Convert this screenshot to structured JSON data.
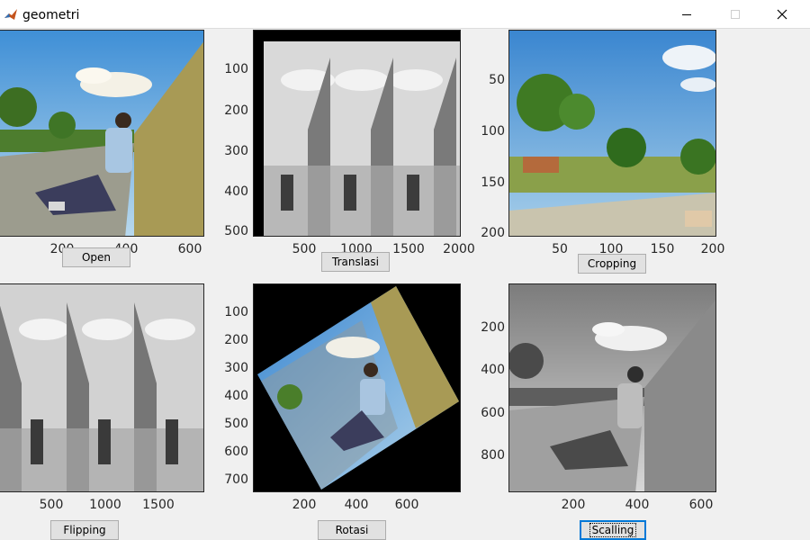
{
  "window": {
    "title": "geometri",
    "icon": "matlab-icon",
    "controls": [
      "minimize-icon",
      "maximize-icon",
      "close-icon"
    ]
  },
  "panels": {
    "open": {
      "xticks": [
        "200",
        "400",
        "600"
      ]
    },
    "translasi": {
      "yticks": [
        "100",
        "200",
        "300",
        "400",
        "500"
      ],
      "xticks": [
        "500",
        "1000",
        "1500",
        "2000"
      ]
    },
    "cropping": {
      "yticks": [
        "50",
        "100",
        "150",
        "200"
      ],
      "xticks": [
        "50",
        "100",
        "150",
        "200"
      ]
    },
    "flipping": {
      "xticks": [
        "500",
        "1000",
        "1500"
      ]
    },
    "rotasi": {
      "yticks": [
        "100",
        "200",
        "300",
        "400",
        "500",
        "600",
        "700"
      ],
      "xticks": [
        "200",
        "400",
        "600"
      ]
    },
    "scalling": {
      "yticks": [
        "200",
        "400",
        "600",
        "800"
      ],
      "xticks": [
        "200",
        "400",
        "600"
      ]
    }
  },
  "buttons": {
    "open": "Open",
    "translasi": "Translasi",
    "cropping": "Cropping",
    "flipping": "Flipping",
    "rotasi": "Rotasi",
    "scalling": "Scalling"
  },
  "colors": {
    "sky": "#5b9bd5",
    "wall": "#a89a55",
    "axis_text": "#262626",
    "button_face": "#e1e1e1",
    "focus_border": "#0078d7"
  }
}
